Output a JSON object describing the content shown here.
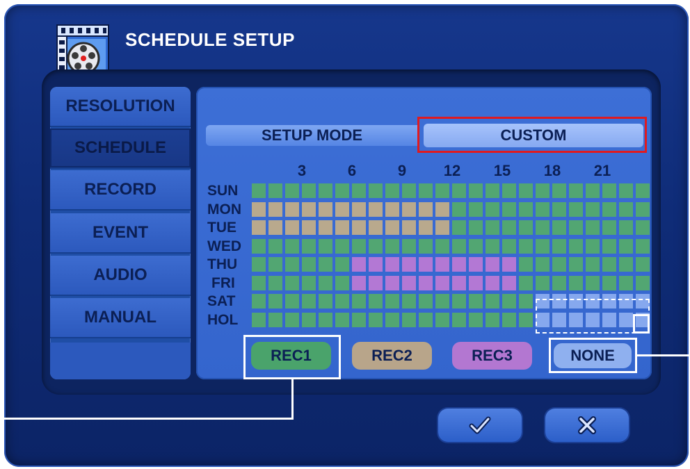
{
  "title": "SCHEDULE SETUP",
  "menu": {
    "items": [
      {
        "label": "RESOLUTION",
        "active": false
      },
      {
        "label": "SCHEDULE",
        "active": true
      },
      {
        "label": "RECORD",
        "active": false
      },
      {
        "label": "EVENT",
        "active": false
      },
      {
        "label": "AUDIO",
        "active": false
      },
      {
        "label": "MANUAL",
        "active": false
      }
    ]
  },
  "setup_mode": {
    "label": "SETUP MODE",
    "value": "CUSTOM"
  },
  "schedule": {
    "hour_labels": [
      "3",
      "6",
      "9",
      "12",
      "15",
      "18",
      "21"
    ],
    "days": [
      "SUN",
      "MON",
      "TUE",
      "WED",
      "THU",
      "FRI",
      "SAT",
      "HOL"
    ],
    "hours_per_day": 24,
    "ranges": [
      {
        "day": "MON",
        "from_hour": 0,
        "to_hour": 11,
        "mode": "REC2"
      },
      {
        "day": "TUE",
        "from_hour": 0,
        "to_hour": 11,
        "mode": "REC2"
      },
      {
        "day": "THU",
        "from_hour": 6,
        "to_hour": 15,
        "mode": "REC3"
      },
      {
        "day": "FRI",
        "from_hour": 6,
        "to_hour": 15,
        "mode": "REC3"
      },
      {
        "day": "SAT",
        "from_hour": 17,
        "to_hour": 23,
        "mode": "NONE"
      },
      {
        "day": "HOL",
        "from_hour": 17,
        "to_hour": 23,
        "mode": "NONE"
      }
    ],
    "default_mode": "REC1"
  },
  "modes": [
    {
      "label": "REC1",
      "color": "#4aa36b",
      "cell_color": "#52a672"
    },
    {
      "label": "REC2",
      "color": "#b8a58a",
      "cell_color": "#b9a98d"
    },
    {
      "label": "REC3",
      "color": "#b377d1",
      "cell_color": "#b378d4"
    },
    {
      "label": "NONE",
      "color": "#8fb0ef",
      "cell_color": "#86a8ee"
    }
  ],
  "actions": {
    "confirm_icon": "checkmark-icon",
    "cancel_icon": "close-icon"
  }
}
